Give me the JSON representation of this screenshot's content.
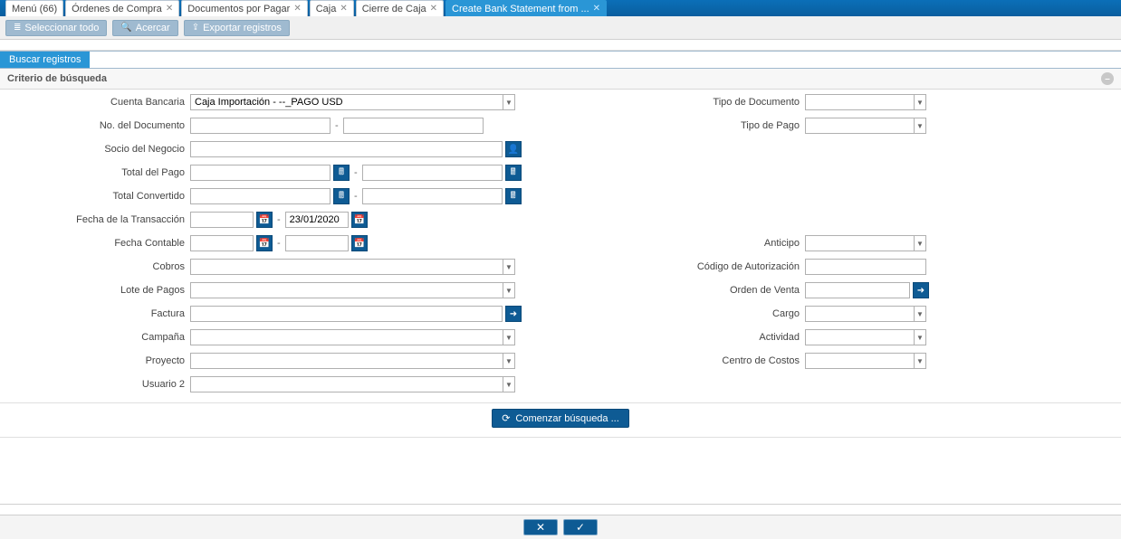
{
  "tabs": [
    {
      "label": "Menú (66)",
      "close": false
    },
    {
      "label": "Órdenes de Compra",
      "close": true
    },
    {
      "label": "Documentos por Pagar",
      "close": true
    },
    {
      "label": "Caja",
      "close": true
    },
    {
      "label": "Cierre de Caja",
      "close": true
    },
    {
      "label": "Create Bank Statement from ...",
      "close": true,
      "active": true
    }
  ],
  "toolbar": {
    "select_all": "Seleccionar todo",
    "zoom": "Acercar",
    "export": "Exportar registros"
  },
  "section": {
    "search_records": "Buscar registros"
  },
  "panel": {
    "criteria_title": "Criterio de búsqueda"
  },
  "labels": {
    "bank_account": "Cuenta Bancaria",
    "doc_no": "No. del Documento",
    "bpartner": "Socio del Negocio",
    "pay_total": "Total del Pago",
    "conv_total": "Total Convertido",
    "trx_date": "Fecha de la Transacción",
    "acct_date": "Fecha Contable",
    "collections": "Cobros",
    "pay_batch": "Lote de Pagos",
    "invoice": "Factura",
    "campaign": "Campaña",
    "project": "Proyecto",
    "user2": "Usuario 2",
    "doc_type": "Tipo de Documento",
    "pay_type": "Tipo de Pago",
    "advance": "Anticipo",
    "auth_code": "Código de Autorización",
    "sales_order": "Orden de Venta",
    "charge": "Cargo",
    "activity": "Actividad",
    "cost_center": "Centro de Costos"
  },
  "values": {
    "bank_account": "Caja Importación - --_PAGO USD",
    "doc_no_from": "",
    "doc_no_to": "",
    "bpartner": "",
    "pay_total_from": "",
    "pay_total_to": "",
    "conv_total_from": "",
    "conv_total_to": "",
    "trx_date_from": "",
    "trx_date_to": "23/01/2020",
    "acct_date_from": "",
    "acct_date_to": "",
    "collections": "",
    "pay_batch": "",
    "invoice": "",
    "campaign": "",
    "project": "",
    "user2": "",
    "doc_type": "",
    "pay_type": "",
    "advance": "",
    "auth_code": "",
    "sales_order": "",
    "charge": "",
    "activity": "",
    "cost_center": ""
  },
  "buttons": {
    "start_search": "Comenzar búsqueda ..."
  }
}
